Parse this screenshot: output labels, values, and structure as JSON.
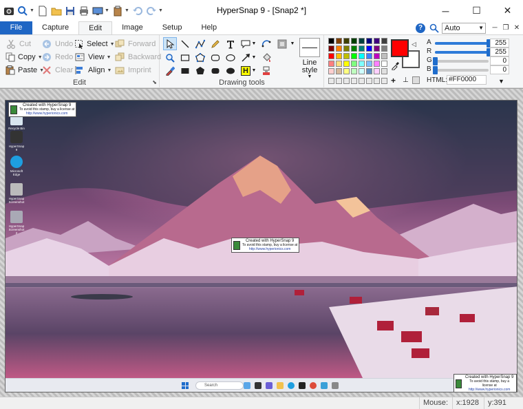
{
  "window": {
    "title": "HyperSnap 9 - [Snap2 *]"
  },
  "tabs": [
    {
      "label": "File"
    },
    {
      "label": "Capture"
    },
    {
      "label": "Edit"
    },
    {
      "label": "Image"
    },
    {
      "label": "Setup"
    },
    {
      "label": "Help"
    }
  ],
  "zoom": {
    "value": "Auto"
  },
  "edit_group": {
    "label": "Edit",
    "cut": "Cut",
    "copy": "Copy",
    "paste": "Paste",
    "undo": "Undo",
    "redo": "Redo",
    "clear": "Clear",
    "select": "Select",
    "view": "View",
    "align": "Align",
    "forward": "Forward",
    "backward": "Backward",
    "imprint": "Imprint"
  },
  "drawing_group": {
    "label": "Drawing tools",
    "line_style": "Line style",
    "highlight_letter": "H"
  },
  "color_panel": {
    "current_color": "#FF0000",
    "channels": [
      {
        "label": "A",
        "value": "255",
        "fraction": 1.0
      },
      {
        "label": "R",
        "value": "255",
        "fraction": 1.0
      },
      {
        "label": "G",
        "value": "0",
        "fraction": 0.0
      },
      {
        "label": "B",
        "value": "0",
        "fraction": 0.0
      }
    ],
    "html_label": "HTML:",
    "html_value": "#FF0000",
    "palette": [
      "#000000",
      "#7f3f00",
      "#3f3f00",
      "#004000",
      "#003f3f",
      "#00007f",
      "#3f007f",
      "#3f3f3f",
      "#7f0000",
      "#ff7f00",
      "#7f7f00",
      "#007f00",
      "#007f7f",
      "#0000ff",
      "#7f007f",
      "#7f7f7f",
      "#ff0000",
      "#ffbf00",
      "#bfbf00",
      "#00ff00",
      "#00ffff",
      "#3f7fff",
      "#bf00bf",
      "#bfbfbf",
      "#ff7f7f",
      "#ffdf7f",
      "#ffff00",
      "#7fff7f",
      "#7fffff",
      "#7fbfff",
      "#ff7fff",
      "#ffffff",
      "#ffcfcf",
      "#d6b89a",
      "#ffff7f",
      "#bfffbf",
      "#cfffff",
      "#5f8fbf",
      "#ffcfff",
      "#e0e0e0"
    ]
  },
  "capture": {
    "stamp_line1": "Created with HyperSnap 9",
    "stamp_line2": "To avoid this stamp, buy a license at",
    "stamp_line3": "http://www.hyperionics.com",
    "desktop_icons": [
      {
        "label": "Recycle Bin"
      },
      {
        "label": "HyperSnap 9"
      },
      {
        "label": "Microsoft Edge"
      },
      {
        "label": "HyperSnap Screenshot"
      },
      {
        "label": "HyperSnap Screenshot 2"
      }
    ],
    "taskbar_search": "Search"
  },
  "status": {
    "mouse_label": "Mouse:",
    "x": "x:1928",
    "y": "y:391"
  }
}
